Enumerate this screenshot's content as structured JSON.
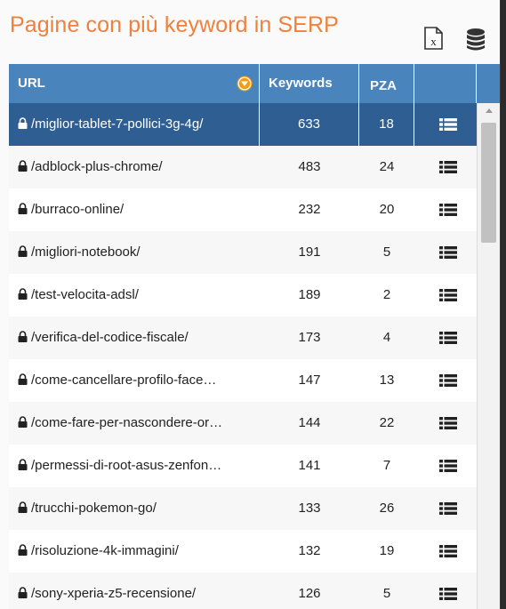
{
  "title": "Pagine con più keyword in SERP",
  "toolbar": {
    "excel_icon": "excel-x-icon",
    "db_icon": "database-icon"
  },
  "columns": {
    "url": "URL",
    "keywords": "Keywords",
    "pza": "PZA",
    "action": ""
  },
  "colors": {
    "title": "#f0803a",
    "header": "#4a84bd",
    "selected": "#2f5e92",
    "filter": "#f39c12"
  },
  "rows": [
    {
      "url": "/miglior-tablet-7-pollici-3g-4g/",
      "keywords": "633",
      "pza": "18",
      "selected": true
    },
    {
      "url": "/adblock-plus-chrome/",
      "keywords": "483",
      "pza": "24"
    },
    {
      "url": "/burraco-online/",
      "keywords": "232",
      "pza": "20"
    },
    {
      "url": "/migliori-notebook/",
      "keywords": "191",
      "pza": "5"
    },
    {
      "url": "/test-velocita-adsl/",
      "keywords": "189",
      "pza": "2"
    },
    {
      "url": "/verifica-del-codice-fiscale/",
      "keywords": "173",
      "pza": "4"
    },
    {
      "url": "/come-cancellare-profilo-face…",
      "keywords": "147",
      "pza": "13"
    },
    {
      "url": "/come-fare-per-nascondere-or…",
      "keywords": "144",
      "pza": "22"
    },
    {
      "url": "/permessi-di-root-asus-zenfon…",
      "keywords": "141",
      "pza": "7"
    },
    {
      "url": "/trucchi-pokemon-go/",
      "keywords": "133",
      "pza": "26"
    },
    {
      "url": "/risoluzione-4k-immagini/",
      "keywords": "132",
      "pza": "19"
    },
    {
      "url": "/sony-xperia-z5-recensione/",
      "keywords": "126",
      "pza": "5"
    }
  ]
}
